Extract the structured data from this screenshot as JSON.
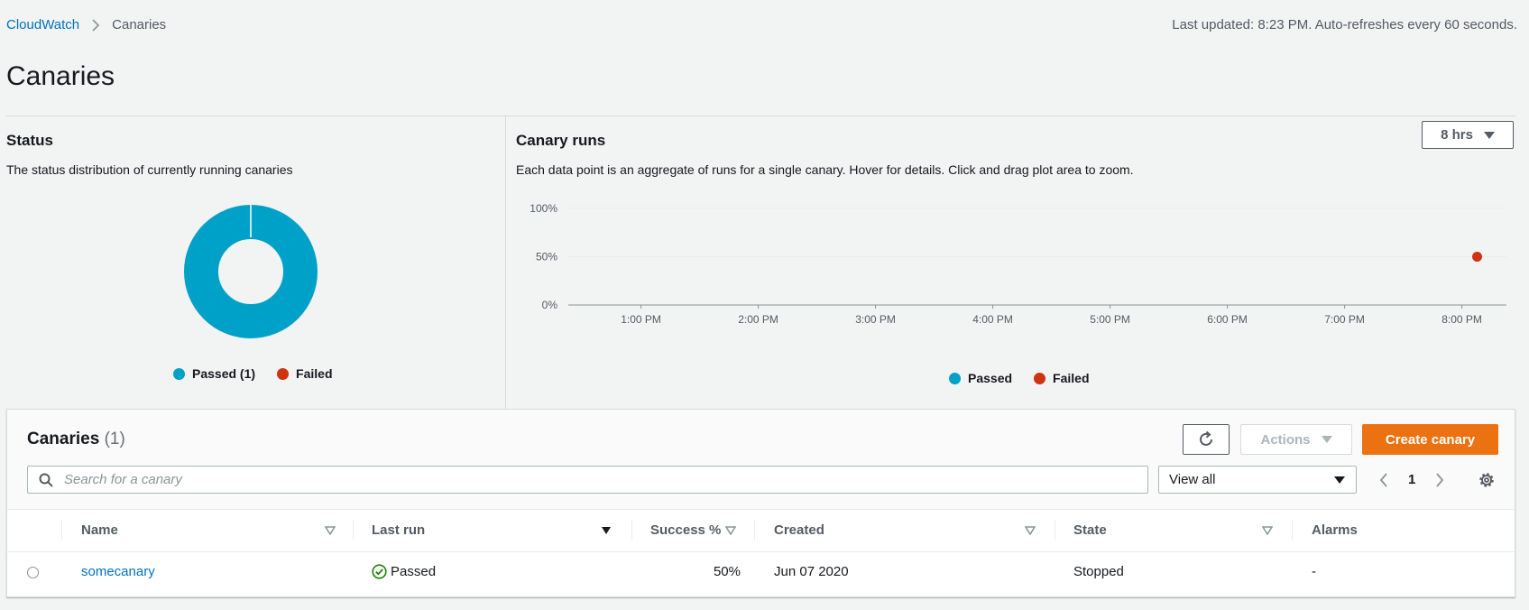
{
  "breadcrumb": {
    "root": "CloudWatch",
    "current": "Canaries"
  },
  "last_updated": "Last updated: 8:23 PM. Auto-refreshes every 60 seconds.",
  "page_title": "Canaries",
  "status_panel": {
    "title": "Status",
    "description": "The status distribution of currently running canaries",
    "legend": [
      {
        "label": "Passed (1)",
        "color": "#00a1c9"
      },
      {
        "label": "Failed",
        "color": "#d13212"
      }
    ]
  },
  "runs_panel": {
    "title": "Canary runs",
    "description": "Each data point is an aggregate of runs for a single canary. Hover for details. Click and drag plot area to zoom.",
    "range_button": "8 hrs",
    "legend": [
      {
        "label": "Passed",
        "color": "#00a1c9"
      },
      {
        "label": "Failed",
        "color": "#d13212"
      }
    ]
  },
  "chart_data": [
    {
      "type": "pie",
      "categories": [
        "Passed",
        "Failed"
      ],
      "values": [
        1,
        0
      ],
      "colors": [
        "#00a1c9",
        "#d13212"
      ]
    },
    {
      "type": "scatter",
      "y_ticks": [
        "100%",
        "50%",
        "0%"
      ],
      "x_ticks": [
        "1:00 PM",
        "2:00 PM",
        "3:00 PM",
        "4:00 PM",
        "5:00 PM",
        "6:00 PM",
        "7:00 PM",
        "8:00 PM"
      ],
      "ylim": [
        0,
        100
      ],
      "xlim_hours": [
        12.38,
        20.38
      ],
      "series": [
        {
          "name": "Passed",
          "color": "#00a1c9",
          "points": []
        },
        {
          "name": "Failed",
          "color": "#d13212",
          "points": [
            {
              "x": "8:08 PM",
              "x_hours": 20.13,
              "y": 50
            }
          ]
        }
      ],
      "grid": true
    }
  ],
  "table": {
    "title": "Canaries",
    "count": "(1)",
    "actions_label": "Actions",
    "create_label": "Create canary",
    "search_placeholder": "Search for a canary",
    "filter_value": "View all",
    "page": "1",
    "columns": [
      "Name",
      "Last run",
      "Success %",
      "Created",
      "State",
      "Alarms"
    ],
    "rows": [
      {
        "name": "somecanary",
        "last_run": "Passed",
        "success": "50%",
        "created": "Jun 07 2020",
        "state": "Stopped",
        "alarms": "-"
      }
    ]
  }
}
